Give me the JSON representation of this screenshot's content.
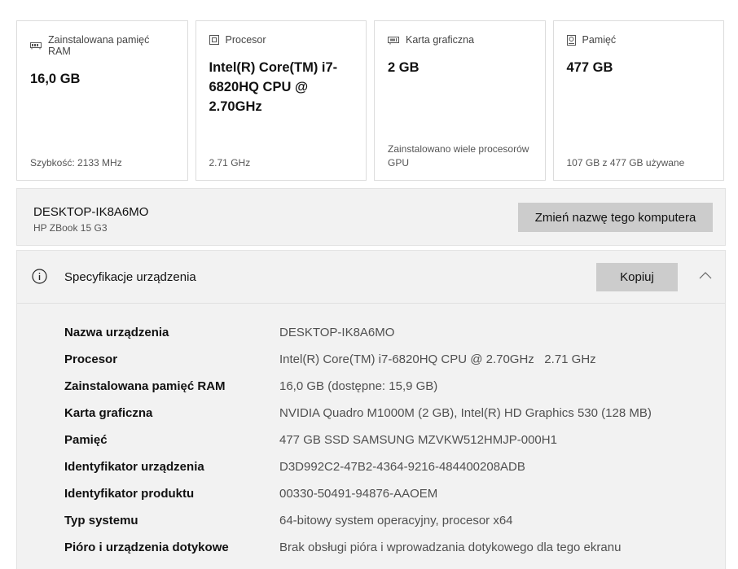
{
  "cards": [
    {
      "icon": "ram-icon",
      "label": "Zainstalowana pamięć RAM",
      "value": "16,0 GB",
      "footer": "Szybkość: 2133 MHz"
    },
    {
      "icon": "processor-icon",
      "label": "Procesor",
      "value": "Intel(R) Core(TM) i7-6820HQ CPU @ 2.70GHz",
      "footer": "2.71 GHz"
    },
    {
      "icon": "graphics-card-icon",
      "label": "Karta graficzna",
      "value": "2 GB",
      "footer": "Zainstalowano wiele procesorów GPU"
    },
    {
      "icon": "storage-icon",
      "label": "Pamięć",
      "value": "477 GB",
      "footer": "107 GB z 477 GB używane"
    }
  ],
  "device": {
    "name": "DESKTOP-IK8A6MO",
    "model": "HP ZBook 15 G3",
    "rename_label": "Zmień nazwę tego komputera"
  },
  "specs": {
    "title": "Specyfikacje urządzenia",
    "copy_label": "Kopiuj",
    "rows": [
      {
        "label": "Nazwa urządzenia",
        "value": "DESKTOP-IK8A6MO"
      },
      {
        "label": "Procesor",
        "value": "Intel(R) Core(TM) i7-6820HQ CPU @ 2.70GHz   2.71 GHz"
      },
      {
        "label": "Zainstalowana pamięć RAM",
        "value": "16,0 GB (dostępne: 15,9 GB)"
      },
      {
        "label": "Karta graficzna",
        "value": "NVIDIA Quadro M1000M (2 GB), Intel(R) HD Graphics 530 (128 MB)"
      },
      {
        "label": "Pamięć",
        "value": "477 GB SSD SAMSUNG MZVKW512HMJP-000H1"
      },
      {
        "label": "Identyfikator urządzenia",
        "value": "D3D992C2-47B2-4364-9216-484400208ADB"
      },
      {
        "label": "Identyfikator produktu",
        "value": "00330-50491-94876-AAOEM"
      },
      {
        "label": "Typ systemu",
        "value": "64-bitowy system operacyjny, procesor x64"
      },
      {
        "label": "Pióro i urządzenia dotykowe",
        "value": "Brak obsługi pióra i wprowadzania dotykowego dla tego ekranu"
      }
    ]
  }
}
